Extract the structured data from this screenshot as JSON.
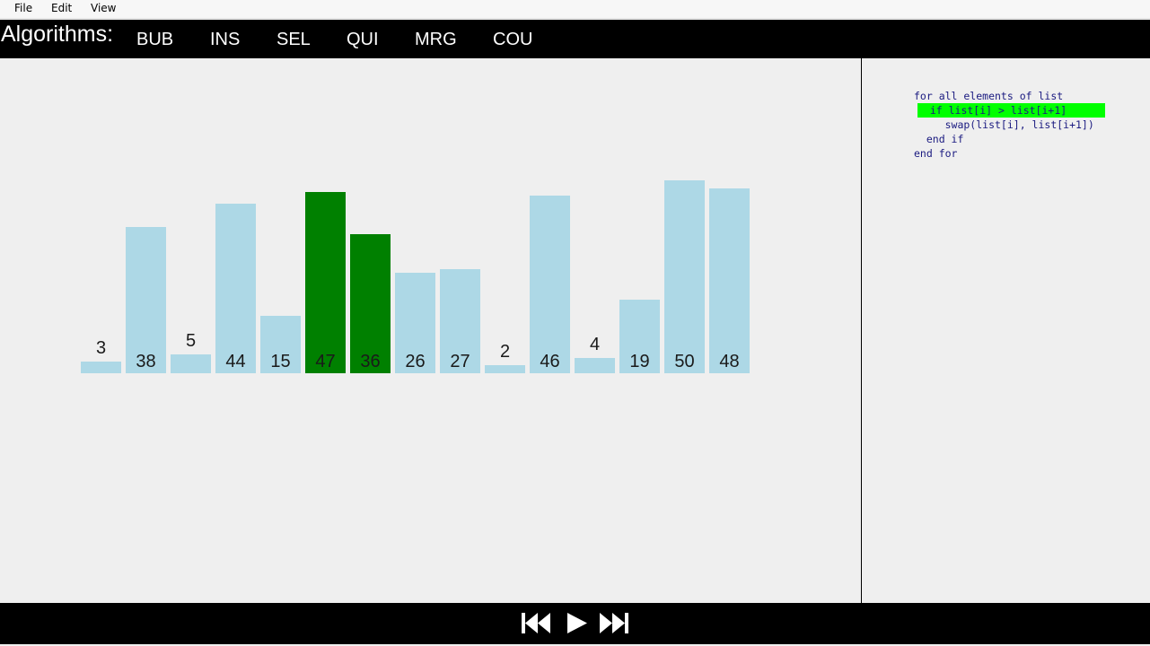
{
  "menu": {
    "file": "File",
    "edit": "Edit",
    "view": "View"
  },
  "algorithms": {
    "title": "Algorithms:",
    "tabs": [
      {
        "label": "BUB",
        "active": false
      },
      {
        "label": "INS",
        "active": false
      },
      {
        "label": "SEL",
        "active": false
      },
      {
        "label": "QUI",
        "active": true
      },
      {
        "label": "MRG",
        "active": false
      },
      {
        "label": "COU",
        "active": false
      }
    ],
    "active_color": "#ff1111"
  },
  "chart_data": {
    "type": "bar",
    "values": [
      3,
      38,
      5,
      44,
      15,
      47,
      36,
      26,
      27,
      2,
      46,
      4,
      19,
      50,
      48
    ],
    "highlighted_indices": [
      5,
      6
    ],
    "bar_color": "#add8e6",
    "highlight_color": "#008000"
  },
  "pseudocode": {
    "lines": [
      "for all elements of list",
      "  if list[i] > list[i+1]",
      "     swap(list[i], list[i+1])",
      "  end if",
      "end for"
    ],
    "highlighted_line": 1,
    "highlight_color": "#00ff00"
  },
  "player": {
    "icons": [
      "skip-back-icon",
      "play-icon",
      "skip-forward-icon"
    ]
  }
}
